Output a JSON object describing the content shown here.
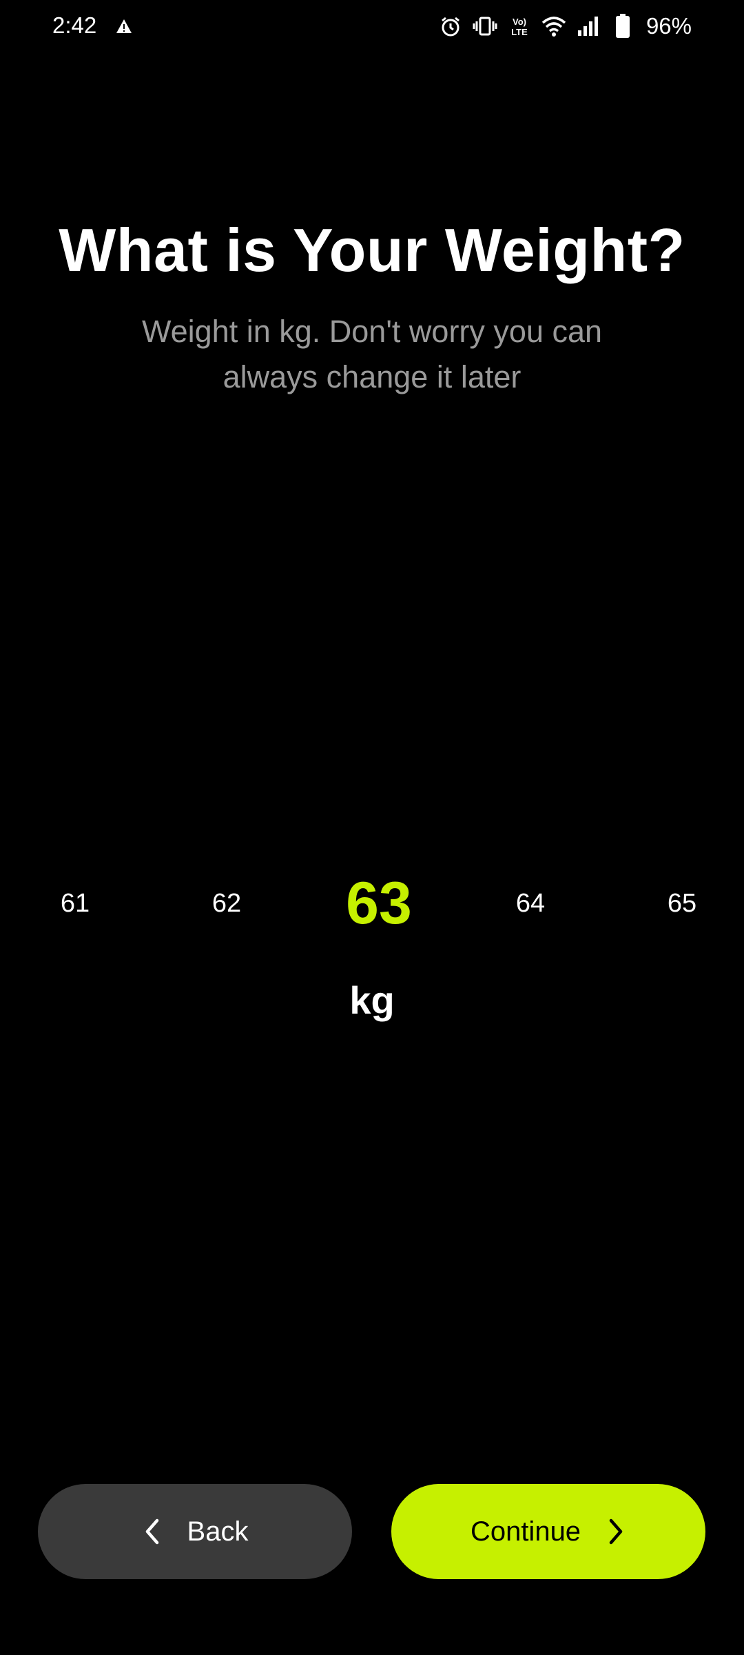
{
  "status_bar": {
    "time": "2:42",
    "battery_percent": "96%",
    "icons": [
      "alert-icon",
      "alarm-icon",
      "vibrate-icon",
      "volte-icon",
      "wifi-icon",
      "signal-icon",
      "battery-icon"
    ]
  },
  "screen": {
    "title": "What is Your Weight?",
    "subtitle": "Weight in kg. Don't worry you can always change it later"
  },
  "picker": {
    "items": [
      "61",
      "62",
      "63",
      "64",
      "65"
    ],
    "selected_value": "63",
    "unit": "kg",
    "accent_color": "#c6f000"
  },
  "buttons": {
    "back_label": "Back",
    "continue_label": "Continue"
  },
  "colors": {
    "background": "#000000",
    "accent": "#c6f000",
    "secondary_button": "#3a3a3a",
    "subtitle": "#9a9a9a"
  }
}
